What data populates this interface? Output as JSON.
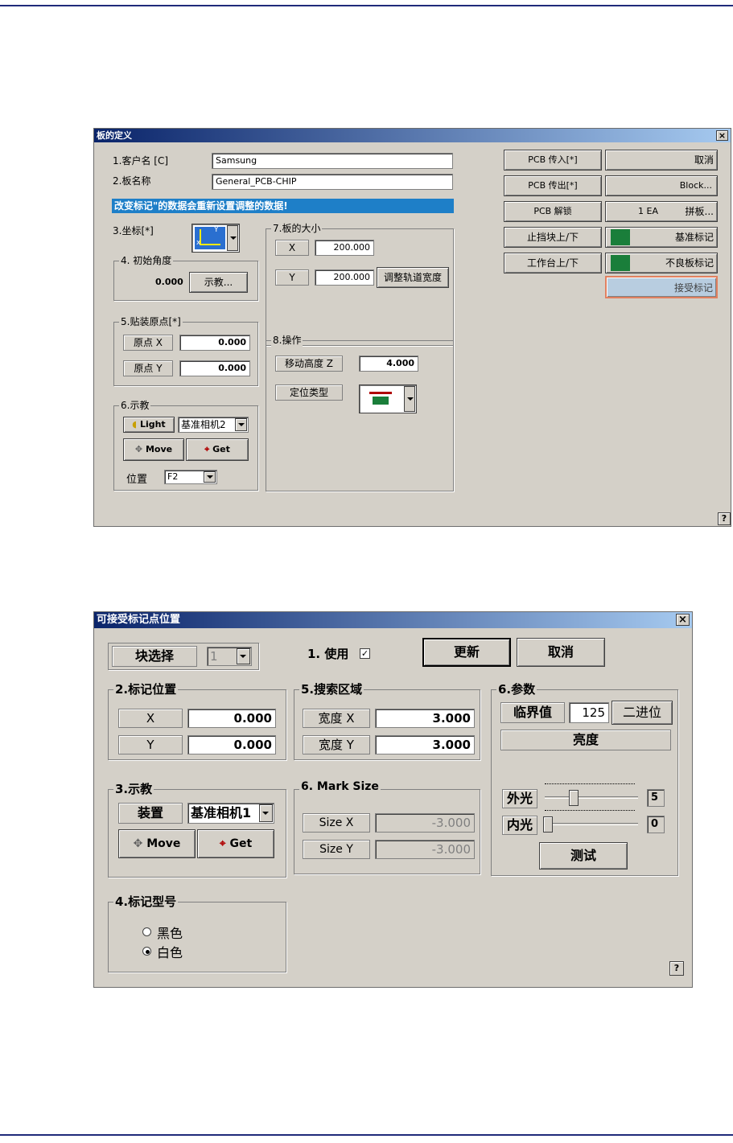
{
  "board": {
    "title": "板的定义",
    "close": "×",
    "customer_label": "1.客户名 [C]",
    "customer_value": "Samsung",
    "board_label": "2.板名称",
    "board_value": "General_PCB-CHIP",
    "warning": "改变标记\"的数据会重新设置调整的数据!",
    "coord_label": "3.坐标[*]",
    "angle_group": "4. 初始角度",
    "angle_value": "0.000",
    "teach_btn": "示教...",
    "origin_group": "5.贴装原点[*]",
    "origin_x_label": "原点 X",
    "origin_x_value": "0.000",
    "origin_y_label": "原点 Y",
    "origin_y_value": "0.000",
    "teach_group": "6.示教",
    "light_btn": "Light",
    "camera_select": "基准相机2",
    "move_btn": "Move",
    "get_btn": "Get",
    "position_label": "位置",
    "position_select": "F2",
    "size_group": "7.板的大小",
    "size_x_label": "X",
    "size_x_value": "200.000",
    "size_y_label": "Y",
    "size_y_value": "200.000",
    "adjust_btn": "调整轨道宽度",
    "op_group": "8.操作",
    "move_height_label": "移动高度 Z",
    "move_height_value": "4.000",
    "locate_type_label": "定位类型",
    "buttons": {
      "pcb_in": "PCB 传入[*]",
      "cancel": "取消",
      "pcb_out": "PCB 传出[*]",
      "block": "Block...",
      "pcb_unlock": "PCB 解锁",
      "ea": "1 EA",
      "panel": "拼板...",
      "stopper": "止挡块上/下",
      "fiducial": "基准标记",
      "table": "工作台上/下",
      "bad_mark": "不良板标记",
      "accept_mark": "接受标记"
    },
    "help": "?"
  },
  "mark": {
    "title": "可接受标记点位置",
    "close": "×",
    "block_select_label": "块选择",
    "block_select_value": "1",
    "use_label": "1. 使用",
    "update_btn": "更新",
    "cancel_btn": "取消",
    "pos_group": "2.标记位置",
    "x_label": "X",
    "x_value": "0.000",
    "y_label": "Y",
    "y_value": "0.000",
    "search_group": "5.搜索区域",
    "width_x_label": "宽度 X",
    "width_x_value": "3.000",
    "width_y_label": "宽度 Y",
    "width_y_value": "3.000",
    "param_group": "6.参数",
    "threshold_label": "临界值",
    "threshold_value": "125",
    "binary_btn": "二进位",
    "brightness_label": "亮度",
    "outer_label": "外光",
    "outer_value": "5",
    "outer_fraction": 0.3,
    "inner_label": "内光",
    "inner_value": "0",
    "inner_fraction": 0.0,
    "test_btn": "测试",
    "teach_group": "3.示教",
    "device_label": "装置",
    "device_select": "基准相机1",
    "move_btn": "Move",
    "get_btn": "Get",
    "marksize_group": "6. Mark Size",
    "size_x_label": "Size X",
    "size_x_value": "-3.000",
    "size_y_label": "Size Y",
    "size_y_value": "-3.000",
    "type_group": "4.标记型号",
    "black_label": "黑色",
    "white_label": "白色",
    "help": "?"
  }
}
